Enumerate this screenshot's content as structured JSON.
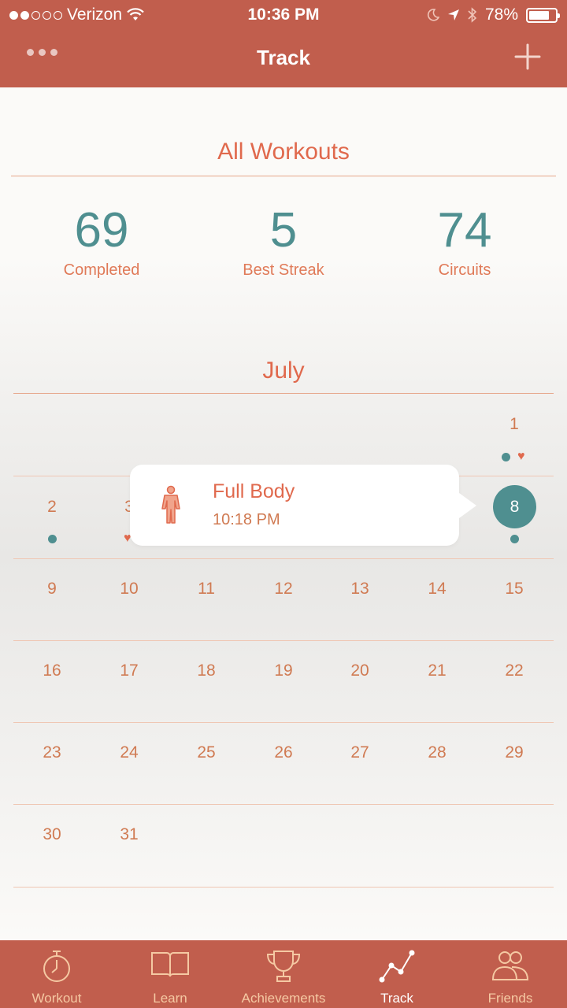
{
  "status_bar": {
    "carrier": "Verizon",
    "time": "10:36 PM",
    "battery": "78%",
    "battery_level": 0.78
  },
  "nav": {
    "title": "Track",
    "more_icon": "ellipsis-icon",
    "add_icon": "plus-icon"
  },
  "summary": {
    "title": "All Workouts",
    "stats": [
      {
        "value": "69",
        "label": "Completed"
      },
      {
        "value": "5",
        "label": "Best Streak"
      },
      {
        "value": "74",
        "label": "Circuits"
      }
    ]
  },
  "calendar": {
    "month": "July",
    "days": {
      "d1": "1",
      "d2": "2",
      "d3": "3",
      "d8": "8",
      "d9": "9",
      "d10": "10",
      "d11": "11",
      "d12": "12",
      "d13": "13",
      "d14": "14",
      "d15": "15",
      "d16": "16",
      "d17": "17",
      "d18": "18",
      "d19": "19",
      "d20": "20",
      "d21": "21",
      "d22": "22",
      "d23": "23",
      "d24": "24",
      "d25": "25",
      "d26": "26",
      "d27": "27",
      "d28": "28",
      "d29": "29",
      "d30": "30",
      "d31": "31"
    },
    "selected_day": "8"
  },
  "popup": {
    "title": "Full Body",
    "time": "10:18 PM",
    "icon": "body-figure-icon"
  },
  "tabs": [
    {
      "label": "Workout",
      "icon": "stopwatch-icon"
    },
    {
      "label": "Learn",
      "icon": "book-icon"
    },
    {
      "label": "Achievements",
      "icon": "trophy-icon"
    },
    {
      "label": "Track",
      "icon": "chart-line-icon",
      "active": true
    },
    {
      "label": "Friends",
      "icon": "people-icon"
    }
  ],
  "colors": {
    "header": "#c15e4d",
    "accent": "#e0694d",
    "teal": "#4f8f90"
  }
}
